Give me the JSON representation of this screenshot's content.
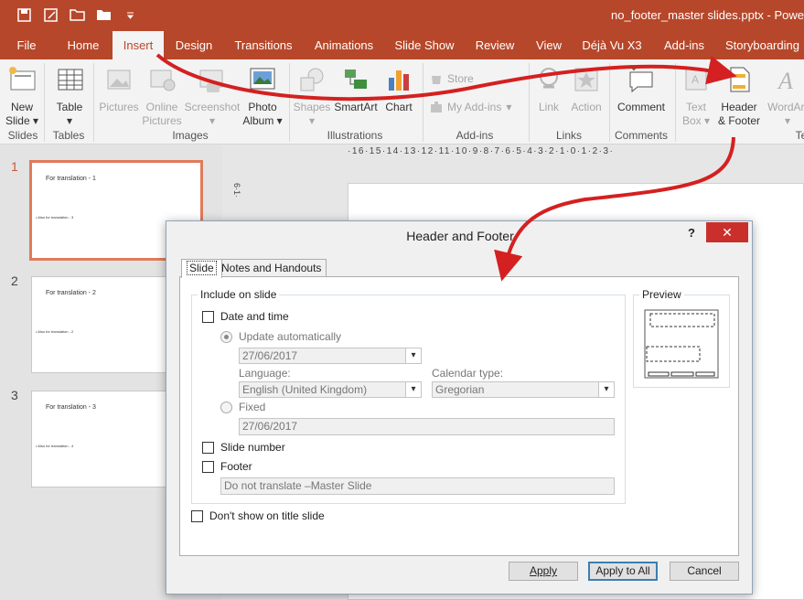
{
  "window": {
    "title": "no_footer_master slides.pptx - Powe"
  },
  "tabs": [
    "File",
    "Home",
    "Insert",
    "Design",
    "Transitions",
    "Animations",
    "Slide Show",
    "Review",
    "View",
    "Déjà Vu X3",
    "Add-ins",
    "Storyboarding"
  ],
  "ribbon": {
    "new_slide": [
      "New",
      "Slide"
    ],
    "table": "Table",
    "pictures": "Pictures",
    "online_pictures": [
      "Online",
      "Pictures"
    ],
    "screenshot": "Screenshot",
    "photo_album": [
      "Photo",
      "Album"
    ],
    "shapes": "Shapes",
    "smartart": "SmartArt",
    "chart": "Chart",
    "store": "Store",
    "my_addins": "My Add-ins",
    "link": "Link",
    "action": "Action",
    "comment": "Comment",
    "text_box": [
      "Text",
      "Box"
    ],
    "header_footer": [
      "Header",
      "& Footer"
    ],
    "wordart": "WordArt",
    "groups": {
      "slides": "Slides",
      "tables": "Tables",
      "images": "Images",
      "illustrations": "Illustrations",
      "addins": "Add-ins",
      "links": "Links",
      "comments": "Comments",
      "text": "Te"
    }
  },
  "ruler": "·16·15·14·13·12·11·10·9·8·7·6·5·4·3·2·1·0·1·2·3·",
  "vruler": "6·1·",
  "slides": [
    {
      "num": "1",
      "title": "For translation - 1",
      "body": "• Also for translation - 3"
    },
    {
      "num": "2",
      "title": "For translation - 2",
      "body": "• Also for translation - 2"
    },
    {
      "num": "3",
      "title": "For translation - 3",
      "body": "• Also for translation - 4"
    }
  ],
  "dialog": {
    "title": "Header and Footer",
    "help": "?",
    "close": "✕",
    "tabs": [
      "Slide",
      "Notes and Handouts"
    ],
    "include_legend": "Include on slide",
    "date_time": "Date and time",
    "update_auto": "Update automatically",
    "date_value": "27/06/2017",
    "language_label": "Language:",
    "language_value": "English (United Kingdom)",
    "calendar_label": "Calendar type:",
    "calendar_value": "Gregorian",
    "fixed": "Fixed",
    "fixed_value": "27/06/2017",
    "slide_number": "Slide number",
    "footer": "Footer",
    "footer_value": "Do not translate –Master Slide",
    "dont_show": "Don't show on title slide",
    "preview_legend": "Preview",
    "apply": "Apply",
    "apply_all": "Apply to All",
    "cancel": "Cancel"
  },
  "colors": {
    "accent": "#b7472a",
    "arrow": "#d42020"
  }
}
